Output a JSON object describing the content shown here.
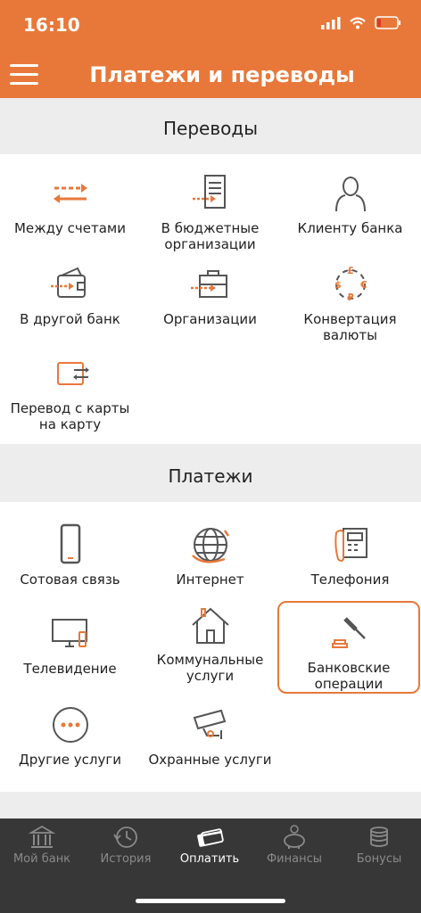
{
  "status": {
    "time": "16:10"
  },
  "header": {
    "title": "Платежи и переводы"
  },
  "transfers": {
    "title": "Переводы",
    "items": [
      {
        "label": "Между счетами"
      },
      {
        "label": "В бюджетные организации"
      },
      {
        "label": "Клиенту банка"
      },
      {
        "label": "В другой банк"
      },
      {
        "label": "Организации"
      },
      {
        "label": "Конвертация валюты"
      },
      {
        "label": "Перевод с карты на карту"
      }
    ]
  },
  "payments": {
    "title": "Платежи",
    "items": [
      {
        "label": "Сотовая связь"
      },
      {
        "label": "Интернет"
      },
      {
        "label": "Телефония"
      },
      {
        "label": "Телевидение"
      },
      {
        "label": "Коммунальные услуги"
      },
      {
        "label": "Банковские операции"
      },
      {
        "label": "Другие услуги"
      },
      {
        "label": "Охранные услуги"
      }
    ]
  },
  "tabs": [
    {
      "label": "Мой банк"
    },
    {
      "label": "История"
    },
    {
      "label": "Оплатить"
    },
    {
      "label": "Финансы"
    },
    {
      "label": "Бонусы"
    }
  ],
  "colors": {
    "accent": "#e8783a",
    "icon": "#555555"
  }
}
